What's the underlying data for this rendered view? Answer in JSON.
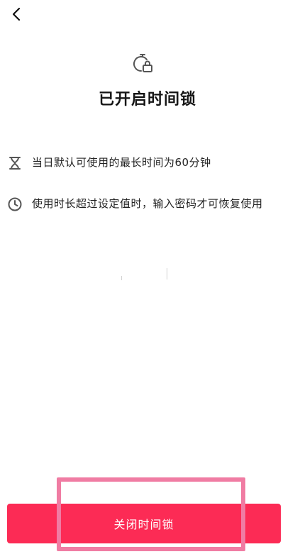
{
  "header": {
    "back_icon": "chevron-left-icon"
  },
  "hero": {
    "icon": "timer-lock-icon",
    "title": "已开启时间锁"
  },
  "info": [
    {
      "icon": "hourglass-icon",
      "text": "当日默认可使用的最长时间为60分钟"
    },
    {
      "icon": "clock-icon",
      "text": "使用时长超过设定值时，输入密码才可恢复使用"
    }
  ],
  "footer": {
    "close_button_label": "关闭时间锁"
  },
  "colors": {
    "primary": "#fc2b55",
    "highlight": "#f07ca3",
    "text": "#1a1a1a",
    "icon": "#555555"
  }
}
